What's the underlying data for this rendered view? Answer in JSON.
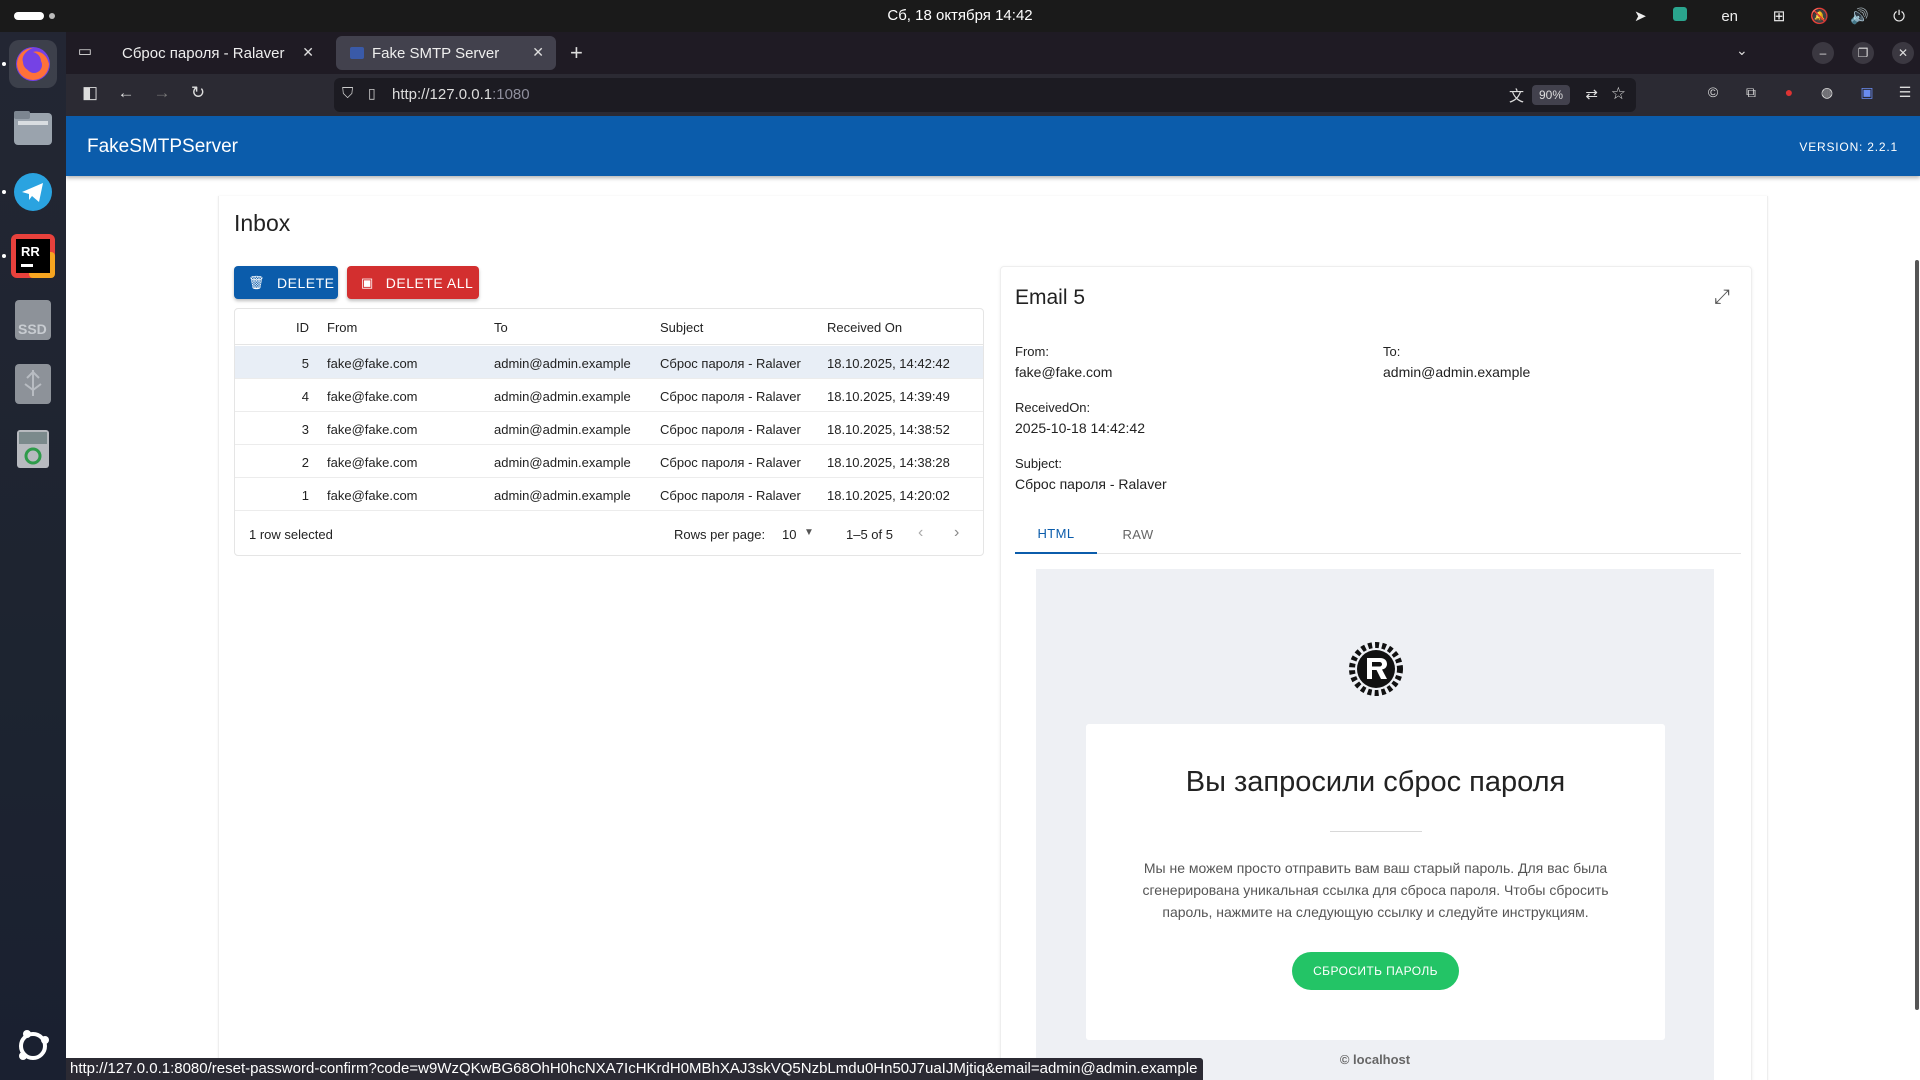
{
  "system": {
    "clock": "Сб, 18 октября  14:42",
    "language": "en"
  },
  "browser": {
    "tabs": [
      {
        "title": "Сброс пароля - Ralaver",
        "active": false
      },
      {
        "title": "Fake SMTP Server",
        "active": true
      }
    ],
    "url_host": "http://127.0.0.1",
    "url_port": ":1080",
    "zoom": "90%",
    "status_url": "http://127.0.0.1:8080/reset-password-confirm?code=w9WzQKwBG68OhH0hcNXA7IcHKrdH0MBhXAJ3skVQ5NzbLmdu0Hn50J7uaIJMjtiq&email=admin@admin.example"
  },
  "app": {
    "title": "FakeSMTPServer",
    "version": "VERSION: 2.2.1"
  },
  "inbox": {
    "title": "Inbox",
    "delete_label": "DELETE",
    "delete_all_label": "DELETE ALL",
    "columns": [
      "ID",
      "From",
      "To",
      "Subject",
      "Received On"
    ],
    "rows": [
      {
        "id": "5",
        "from": "fake@fake.com",
        "to": "admin@admin.example",
        "subject": "Сброс пароля - Ralaver",
        "received": "18.10.2025, 14:42:42",
        "selected": true
      },
      {
        "id": "4",
        "from": "fake@fake.com",
        "to": "admin@admin.example",
        "subject": "Сброс пароля - Ralaver",
        "received": "18.10.2025, 14:39:49",
        "selected": false
      },
      {
        "id": "3",
        "from": "fake@fake.com",
        "to": "admin@admin.example",
        "subject": "Сброс пароля - Ralaver",
        "received": "18.10.2025, 14:38:52",
        "selected": false
      },
      {
        "id": "2",
        "from": "fake@fake.com",
        "to": "admin@admin.example",
        "subject": "Сброс пароля - Ralaver",
        "received": "18.10.2025, 14:38:28",
        "selected": false
      },
      {
        "id": "1",
        "from": "fake@fake.com",
        "to": "admin@admin.example",
        "subject": "Сброс пароля - Ralaver",
        "received": "18.10.2025, 14:20:02",
        "selected": false
      }
    ],
    "footer": {
      "selection": "1 row selected",
      "rows_per_page_label": "Rows per page:",
      "rows_per_page_value": "10",
      "range": "1–5 of 5"
    }
  },
  "email": {
    "title": "Email 5",
    "from_label": "From:",
    "from": "fake@fake.com",
    "to_label": "To:",
    "to": "admin@admin.example",
    "received_label": "ReceivedOn:",
    "received": "2025-10-18 14:42:42",
    "subject_label": "Subject:",
    "subject": "Сброс пароля - Ralaver",
    "tabs": [
      "HTML",
      "RAW"
    ],
    "active_tab": "HTML",
    "body": {
      "heading": "Вы запросили сброс пароля",
      "text": "Мы не можем просто отправить вам ваш старый пароль. Для вас была сгенерирована уникальная ссылка для сброса пароля. Чтобы сбросить пароль, нажмите на следующую ссылку и следуйте инструкциям.",
      "button": "СБРОСИТЬ ПАРОЛЬ",
      "footer": "© localhost"
    }
  },
  "colors": {
    "primary": "#0b5cab",
    "danger": "#d32f2f",
    "success": "#23c466"
  }
}
